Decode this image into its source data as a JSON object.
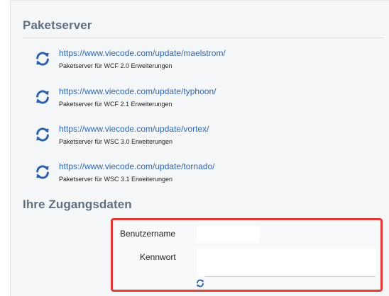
{
  "package_servers": {
    "title": "Paketserver",
    "items": [
      {
        "url": "https://www.viecode.com/update/maelstrom/",
        "description": "Paketserver für WCF 2.0 Erweiterungen"
      },
      {
        "url": "https://www.viecode.com/update/typhoon/",
        "description": "Paketserver für WCF 2.1 Erweiterungen"
      },
      {
        "url": "https://www.viecode.com/update/vortex/",
        "description": "Paketserver für WSC 3.0 Erweiterungen"
      },
      {
        "url": "https://www.viecode.com/update/tornado/",
        "description": "Paketserver für WSC 3.1 Erweiterungen"
      }
    ]
  },
  "credentials": {
    "title": "Ihre Zugangsdaten",
    "username_label": "Benutzername",
    "username_value": "",
    "password_label": "Kennwort",
    "password_value": ""
  },
  "icons": {
    "refresh": "refresh-icon"
  },
  "colors": {
    "link": "#2f67b2",
    "icon": "#2c5fa8",
    "highlight_border": "#e03a37",
    "section_title": "#5f6f7d"
  }
}
